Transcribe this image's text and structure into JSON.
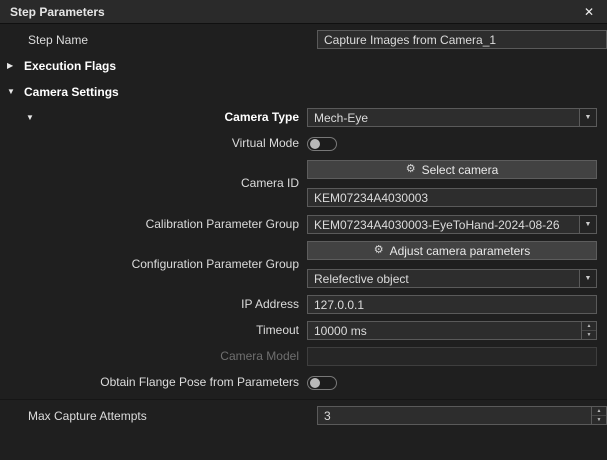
{
  "panel": {
    "title": "Step Parameters"
  },
  "icons": {
    "close": "✕",
    "gear": "⚙",
    "collapsed": "▶",
    "expanded": "▼",
    "dropdown_arrow": "▼",
    "spin_up": "▲",
    "spin_down": "▼"
  },
  "step_name": {
    "label": "Step Name",
    "value": "Capture Images from Camera_1"
  },
  "sections": {
    "execution_flags": {
      "label": "Execution Flags"
    },
    "camera_settings": {
      "label": "Camera Settings"
    }
  },
  "camera": {
    "camera_type": {
      "label": "Camera Type",
      "value": "Mech-Eye"
    },
    "virtual_mode": {
      "label": "Virtual Mode",
      "state": "off"
    },
    "select_camera_button": {
      "label": "Select camera"
    },
    "camera_id": {
      "label": "Camera ID",
      "value": "KEM07234A4030003"
    },
    "calibration_group": {
      "label": "Calibration Parameter Group",
      "value": "KEM07234A4030003-EyeToHand-2024-08-26"
    },
    "adjust_button": {
      "label": "Adjust camera parameters"
    },
    "config_group": {
      "label": "Configuration Parameter Group",
      "value": "Relefective object"
    },
    "ip_address": {
      "label": "IP Address",
      "value": "127.0.0.1"
    },
    "timeout": {
      "label": "Timeout",
      "value": "10000 ms"
    },
    "camera_model": {
      "label": "Camera Model",
      "value": ""
    },
    "obtain_flange": {
      "label": "Obtain Flange Pose from Parameters",
      "state": "off"
    }
  },
  "max_capture_attempts": {
    "label": "Max Capture Attempts",
    "value": "3"
  }
}
